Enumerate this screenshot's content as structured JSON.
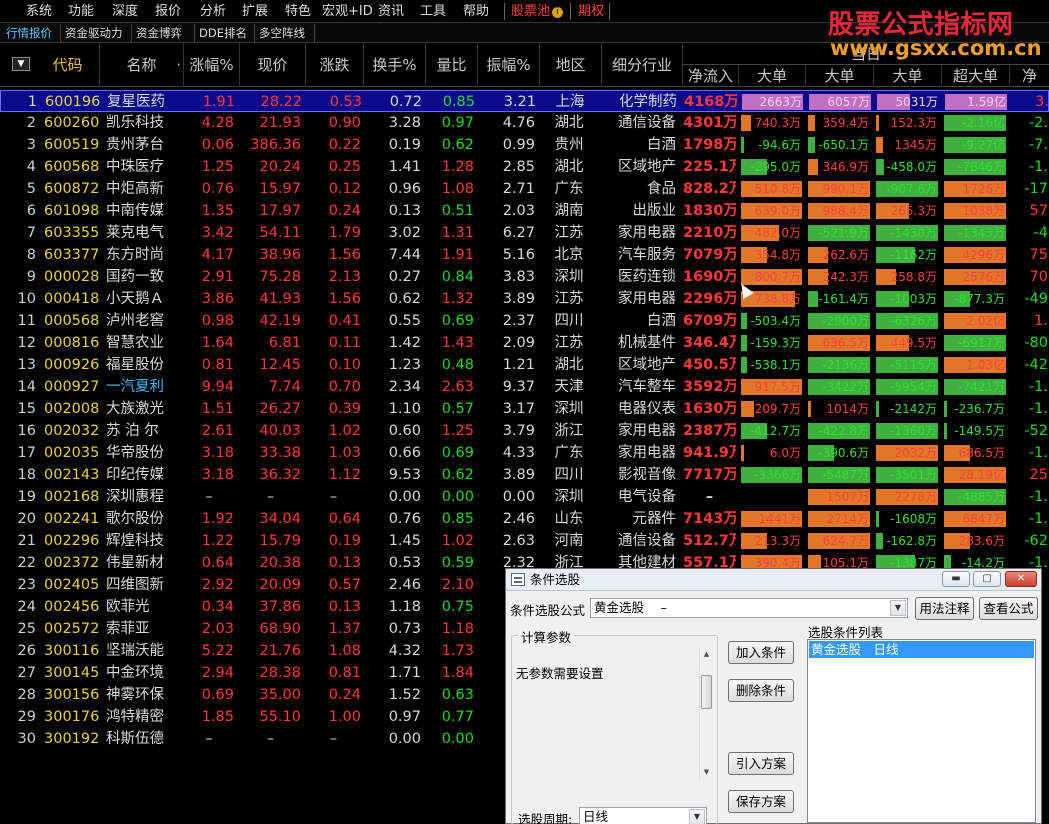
{
  "menu": {
    "items": [
      "系统",
      "功能",
      "深度",
      "报价",
      "分析",
      "扩展",
      "特色",
      "宏观+ID",
      "资讯",
      "工具",
      "帮助"
    ],
    "stock_pool": "股票池",
    "stock_pool_icon": "coin-icon",
    "coin_glyph": "i",
    "options": "期权"
  },
  "tabs": [
    "行情报价",
    "资金驱动力",
    "资金博弈",
    "DDE排名",
    "多空阵线"
  ],
  "watermark": {
    "title": "股票公式指标网",
    "url": "www.gsxx.com.cn"
  },
  "header": {
    "sort_glyph": "▼",
    "code": "代码",
    "name": "名称",
    "name_dot": "·",
    "pct": "涨幅%",
    "price": "现价",
    "chg": "涨跌",
    "turnover": "换手%",
    "volratio": "量比",
    "amplitude": "振幅%",
    "region": "地区",
    "industry": "细分行业",
    "dangri": "当日",
    "netflow": "净流入",
    "big": [
      "大单",
      "大单",
      "大单",
      "超大单",
      "净"
    ]
  },
  "rows": [
    {
      "n": "1",
      "code": "600196",
      "name": "复星医药",
      "pct": "1.91",
      "price": "28.22",
      "chg": "0.53",
      "turn": "0.72",
      "vr": "0.85",
      "amp": "3.21",
      "region": "上海",
      "ind": "化学制药",
      "net": "4168万",
      "b": [
        "2663万",
        "6057万",
        "5031万",
        "1.59亿",
        "3."
      ]
    },
    {
      "n": "2",
      "code": "600260",
      "name": "凯乐科技",
      "pct": "4.28",
      "price": "21.93",
      "chg": "0.90",
      "turn": "3.28",
      "vr": "0.97",
      "amp": "4.76",
      "region": "湖北",
      "ind": "通信设备",
      "net": "4301万",
      "b": [
        "740.3万",
        "359.4万",
        "152.3万",
        "-2.16亿",
        "-2."
      ]
    },
    {
      "n": "3",
      "code": "600519",
      "name": "贵州茅台",
      "pct": "0.06",
      "price": "386.36",
      "chg": "0.22",
      "turn": "0.19",
      "vr": "0.62",
      "amp": "0.99",
      "region": "贵州",
      "ind": "白酒",
      "net": "1798万",
      "b": [
        "-94.6万",
        "-650.1万",
        "1345万",
        "-9.27亿",
        "-7."
      ]
    },
    {
      "n": "4",
      "code": "600568",
      "name": "中珠医疗",
      "pct": "1.25",
      "price": "20.24",
      "chg": "0.25",
      "turn": "1.41",
      "vr": "1.28",
      "amp": "2.85",
      "region": "湖北",
      "ind": "区域地产",
      "net": "225.1万",
      "b": [
        "-295.0万",
        "346.9万",
        "-458.0万",
        "-7846万",
        "-1."
      ]
    },
    {
      "n": "5",
      "code": "600872",
      "name": "中炬高新",
      "pct": "0.76",
      "price": "15.97",
      "chg": "0.12",
      "turn": "0.96",
      "vr": "1.08",
      "amp": "2.71",
      "region": "广东",
      "ind": "食品",
      "net": "828.2万",
      "b": [
        "510.8万",
        "990.1万",
        "-907.6万",
        "1726万",
        "-17"
      ]
    },
    {
      "n": "6",
      "code": "601098",
      "name": "中南传媒",
      "pct": "1.35",
      "price": "17.97",
      "chg": "0.24",
      "turn": "0.13",
      "vr": "0.51",
      "amp": "2.03",
      "region": "湖南",
      "ind": "出版业",
      "net": "1830万",
      "b": [
        "639.0万",
        "988.4万",
        "265.3万",
        "1038万",
        "57"
      ]
    },
    {
      "n": "7",
      "code": "603355",
      "name": "莱克电气",
      "pct": "3.42",
      "price": "54.11",
      "chg": "1.79",
      "turn": "3.02",
      "vr": "1.31",
      "amp": "6.27",
      "region": "江苏",
      "ind": "家用电器",
      "net": "2210万",
      "b": [
        "482.0万",
        "-521.9万",
        "-1430万",
        "-1343万",
        "-4"
      ]
    },
    {
      "n": "8",
      "code": "603377",
      "name": "东方时尚",
      "pct": "4.17",
      "price": "38.96",
      "chg": "1.56",
      "turn": "7.44",
      "vr": "1.91",
      "amp": "5.16",
      "region": "北京",
      "ind": "汽车服务",
      "net": "7079万",
      "b": [
        "354.8万",
        "262.6万",
        "-1162万",
        "4296万",
        "75"
      ]
    },
    {
      "n": "9",
      "code": "000028",
      "name": "国药一致",
      "pct": "2.91",
      "price": "75.28",
      "chg": "2.13",
      "turn": "0.27",
      "vr": "0.84",
      "amp": "3.83",
      "region": "深圳",
      "ind": "医药连锁",
      "net": "1690万",
      "b": [
        "800.7万",
        "242.3万",
        "258.8万",
        "2576万",
        "70"
      ]
    },
    {
      "n": "10",
      "code": "000418",
      "name": "小天鹅Ａ",
      "pct": "3.86",
      "price": "41.93",
      "chg": "1.56",
      "turn": "0.62",
      "vr": "1.32",
      "amp": "3.89",
      "region": "江苏",
      "ind": "家用电器",
      "net": "2296万",
      "b": [
        "738.8万",
        "-161.4万",
        "-1003万",
        "-877.3万",
        "-49"
      ]
    },
    {
      "n": "11",
      "code": "000568",
      "name": "泸州老窖",
      "pct": "0.98",
      "price": "42.19",
      "chg": "0.41",
      "turn": "0.55",
      "vr": "0.69",
      "amp": "2.37",
      "region": "四川",
      "ind": "白酒",
      "net": "6709万",
      "b": [
        "-503.4万",
        "-2900万",
        "-6326万",
        "2.02亿",
        "1."
      ]
    },
    {
      "n": "12",
      "code": "000816",
      "name": "智慧农业",
      "pct": "1.64",
      "price": "6.81",
      "chg": "0.11",
      "turn": "1.42",
      "vr": "1.43",
      "amp": "2.09",
      "region": "江苏",
      "ind": "机械基件",
      "net": "346.4万",
      "b": [
        "-159.3万",
        "636.5万",
        "449.5万",
        "-6917万",
        "-80"
      ]
    },
    {
      "n": "13",
      "code": "000926",
      "name": "福星股份",
      "pct": "0.81",
      "price": "12.45",
      "chg": "0.10",
      "turn": "1.23",
      "vr": "0.48",
      "amp": "1.21",
      "region": "湖北",
      "ind": "区域地产",
      "net": "450.5万",
      "b": [
        "-538.1万",
        "-2136万",
        "-5115万",
        "1.03亿",
        "-42"
      ]
    },
    {
      "n": "14",
      "code": "000927",
      "name": "一汽夏利",
      "pct": "9.94",
      "price": "7.74",
      "chg": "0.70",
      "turn": "2.34",
      "vr": "2.63",
      "amp": "9.37",
      "region": "天津",
      "ind": "汽车整车",
      "net": "3592万",
      "b": [
        "917.5万",
        "-3422万",
        "-5954万",
        "-7421万",
        "-1."
      ]
    },
    {
      "n": "15",
      "code": "002008",
      "name": "大族激光",
      "pct": "1.51",
      "price": "26.27",
      "chg": "0.39",
      "turn": "1.10",
      "vr": "0.57",
      "amp": "3.17",
      "region": "深圳",
      "ind": "电器仪表",
      "net": "1630万",
      "b": [
        "209.7万",
        "1014万",
        "-2142万",
        "-236.7万",
        "-1."
      ]
    },
    {
      "n": "16",
      "code": "002032",
      "name": "苏 泊 尔",
      "pct": "2.61",
      "price": "40.03",
      "chg": "1.02",
      "turn": "0.60",
      "vr": "1.25",
      "amp": "3.79",
      "region": "浙江",
      "ind": "家用电器",
      "net": "2387万",
      "b": [
        "-412.7万",
        "-422.8万",
        "-1360万",
        "-149.5万",
        "-52"
      ]
    },
    {
      "n": "17",
      "code": "002035",
      "name": "华帝股份",
      "pct": "3.18",
      "price": "33.38",
      "chg": "1.03",
      "turn": "0.66",
      "vr": "0.69",
      "amp": "4.33",
      "region": "广东",
      "ind": "家用电器",
      "net": "941.9万",
      "b": [
        "6.0万",
        "-390.6万",
        "2032万",
        "686.5万",
        "-1."
      ]
    },
    {
      "n": "18",
      "code": "002143",
      "name": "印纪传媒",
      "pct": "3.18",
      "price": "36.32",
      "chg": "1.12",
      "turn": "9.53",
      "vr": "0.62",
      "amp": "3.89",
      "region": "四川",
      "ind": "影视音像",
      "net": "7717万",
      "b": [
        "-3366万",
        "-5487万",
        "-3501万",
        "28.19亿",
        "25"
      ]
    },
    {
      "n": "19",
      "code": "002168",
      "name": "深圳惠程",
      "pct": "–",
      "price": "–",
      "chg": "–",
      "turn": "0.00",
      "vr": "0.00",
      "amp": "0.00",
      "region": "深圳",
      "ind": "电气设备",
      "net": "–",
      "b": [
        "",
        "1507万",
        "2278万",
        "-4885万",
        "-1."
      ]
    },
    {
      "n": "20",
      "code": "002241",
      "name": "歌尔股份",
      "pct": "1.92",
      "price": "34.04",
      "chg": "0.64",
      "turn": "0.76",
      "vr": "0.85",
      "amp": "2.46",
      "region": "山东",
      "ind": "元器件",
      "net": "7143万",
      "b": [
        "1441万",
        "2714万",
        "-1608万",
        "6847万",
        "-1."
      ]
    },
    {
      "n": "21",
      "code": "002296",
      "name": "辉煌科技",
      "pct": "1.22",
      "price": "15.79",
      "chg": "0.19",
      "turn": "1.45",
      "vr": "1.02",
      "amp": "2.63",
      "region": "河南",
      "ind": "通信设备",
      "net": "512.7万",
      "b": [
        "213.3万",
        "624.7万",
        "-162.8万",
        "283.6万",
        "-62"
      ]
    },
    {
      "n": "22",
      "code": "002372",
      "name": "伟星新材",
      "pct": "0.64",
      "price": "20.38",
      "chg": "0.13",
      "turn": "0.53",
      "vr": "0.59",
      "amp": "2.32",
      "region": "浙江",
      "ind": "其他建材",
      "net": "557.1万",
      "b": [
        "390.4万",
        "105.1万",
        "-1387万",
        "-14.2万",
        "-1."
      ]
    },
    {
      "n": "23",
      "code": "002405",
      "name": "四维图新",
      "pct": "2.92",
      "price": "20.09",
      "chg": "0.57",
      "turn": "2.46",
      "vr": "2.10",
      "amp": "",
      "region": "",
      "ind": "",
      "net": "",
      "b": [
        "",
        "",
        "",
        "",
        ""
      ]
    },
    {
      "n": "24",
      "code": "002456",
      "name": "欧菲光",
      "pct": "0.34",
      "price": "37.86",
      "chg": "0.13",
      "turn": "1.18",
      "vr": "0.75",
      "amp": "",
      "region": "",
      "ind": "",
      "net": "",
      "b": [
        "",
        "",
        "",
        "",
        ""
      ]
    },
    {
      "n": "25",
      "code": "002572",
      "name": "索菲亚",
      "pct": "2.03",
      "price": "68.90",
      "chg": "1.37",
      "turn": "0.73",
      "vr": "1.18",
      "amp": "",
      "region": "",
      "ind": "",
      "net": "",
      "b": [
        "",
        "",
        "",
        "",
        ""
      ]
    },
    {
      "n": "26",
      "code": "300116",
      "name": "坚瑞沃能",
      "pct": "5.22",
      "price": "21.76",
      "chg": "1.08",
      "turn": "4.32",
      "vr": "1.73",
      "amp": "",
      "region": "",
      "ind": "",
      "net": "",
      "b": [
        "",
        "",
        "",
        "",
        ""
      ]
    },
    {
      "n": "27",
      "code": "300145",
      "name": "中金环境",
      "pct": "2.94",
      "price": "28.38",
      "chg": "0.81",
      "turn": "1.71",
      "vr": "1.84",
      "amp": "",
      "region": "",
      "ind": "",
      "net": "",
      "b": [
        "",
        "",
        "",
        "",
        ""
      ]
    },
    {
      "n": "28",
      "code": "300156",
      "name": "神雾环保",
      "pct": "0.69",
      "price": "35.00",
      "chg": "0.24",
      "turn": "1.52",
      "vr": "0.63",
      "amp": "",
      "region": "",
      "ind": "",
      "net": "",
      "b": [
        "",
        "",
        "",
        "",
        ""
      ]
    },
    {
      "n": "29",
      "code": "300176",
      "name": "鸿特精密",
      "pct": "1.85",
      "price": "55.10",
      "chg": "1.00",
      "turn": "0.97",
      "vr": "0.77",
      "amp": "",
      "region": "",
      "ind": "",
      "net": "",
      "b": [
        "",
        "",
        "",
        "",
        ""
      ]
    },
    {
      "n": "30",
      "code": "300192",
      "name": "科斯伍德",
      "pct": "–",
      "price": "–",
      "chg": "–",
      "turn": "0.00",
      "vr": "0.00",
      "amp": "",
      "region": "",
      "ind": "",
      "net": "",
      "b": [
        "",
        "",
        "",
        "",
        ""
      ]
    }
  ],
  "bar_fill": [
    [
      0.95,
      0.95,
      0.5,
      0.95
    ],
    [
      0.15,
      0.1,
      0.05,
      0.95
    ],
    [
      0.05,
      0.1,
      0.1,
      0.95
    ],
    [
      0.4,
      0.15,
      0.12,
      0.95
    ],
    [
      0.95,
      0.95,
      0.95,
      0.95
    ],
    [
      0.95,
      0.95,
      0.5,
      0.95
    ],
    [
      0.6,
      0.95,
      0.95,
      0.95
    ],
    [
      0.4,
      0.3,
      0.6,
      0.95
    ],
    [
      0.95,
      0.3,
      0.3,
      0.95
    ],
    [
      0.85,
      0.15,
      0.5,
      0.4
    ],
    [
      0.1,
      0.95,
      0.95,
      0.95
    ],
    [
      0.1,
      0.95,
      0.5,
      0.95
    ],
    [
      0.1,
      0.95,
      0.95,
      0.95
    ],
    [
      0.95,
      0.95,
      0.95,
      0.95
    ],
    [
      0.2,
      0.05,
      0.05,
      0.05
    ],
    [
      0.4,
      0.95,
      0.95,
      0.05
    ],
    [
      0.05,
      0.4,
      0.95,
      0.4
    ],
    [
      0.95,
      0.95,
      0.95,
      0.95
    ],
    [
      0,
      0.95,
      0.95,
      0.95
    ],
    [
      0.95,
      0.95,
      0.05,
      0.95
    ],
    [
      0.4,
      0.95,
      0.1,
      0.4
    ],
    [
      0.95,
      0.2,
      0.6,
      0.1
    ]
  ],
  "bar_color": [
    [
      "p",
      "p",
      "p",
      "p"
    ],
    [
      "r",
      "r",
      "r",
      "g"
    ],
    [
      "g",
      "g",
      "r",
      "g"
    ],
    [
      "g",
      "r",
      "g",
      "g"
    ],
    [
      "r",
      "r",
      "g",
      "r"
    ],
    [
      "r",
      "r",
      "r",
      "r"
    ],
    [
      "r",
      "g",
      "g",
      "g"
    ],
    [
      "r",
      "r",
      "g",
      "r"
    ],
    [
      "r",
      "r",
      "r",
      "r"
    ],
    [
      "r",
      "g",
      "g",
      "g"
    ],
    [
      "g",
      "g",
      "g",
      "r"
    ],
    [
      "g",
      "r",
      "r",
      "g"
    ],
    [
      "g",
      "g",
      "g",
      "r"
    ],
    [
      "r",
      "g",
      "g",
      "g"
    ],
    [
      "r",
      "r",
      "g",
      "g"
    ],
    [
      "g",
      "g",
      "g",
      "g"
    ],
    [
      "r",
      "g",
      "r",
      "r"
    ],
    [
      "g",
      "g",
      "g",
      "r"
    ],
    [
      "r",
      "r",
      "r",
      "g"
    ],
    [
      "r",
      "r",
      "g",
      "r"
    ],
    [
      "r",
      "r",
      "g",
      "r"
    ],
    [
      "r",
      "r",
      "g",
      "g"
    ]
  ],
  "dialog": {
    "title": "条件选股",
    "formula_label": "条件选股公式",
    "formula_value": "黄金选股　 –",
    "btn_usage": "用法注释",
    "btn_view": "查看公式",
    "calc_group": "计算参数",
    "no_params": "无参数需要设置",
    "btn_add": "加入条件",
    "btn_del": "删除条件",
    "list_label": "选股条件列表",
    "list_item": "黄金选股　日线",
    "btn_import": "引入方案",
    "btn_save": "保存方案",
    "period_label": "选股周期:",
    "period_value": "日线",
    "min_glyph": "▬",
    "max_glyph": "▢",
    "close_glyph": "✕",
    "arrow_glyph": "▼",
    "up_glyph": "▲"
  }
}
